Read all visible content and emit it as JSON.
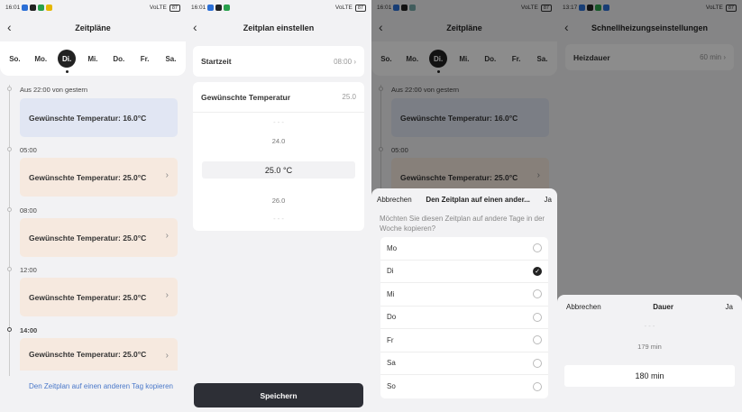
{
  "screen1": {
    "status_time": "16:01",
    "network": "VoLTE",
    "battery": "87",
    "title": "Zeitpläne",
    "days": [
      "So.",
      "Mo.",
      "Di.",
      "Mi.",
      "Do.",
      "Fr.",
      "Sa."
    ],
    "selected_day": "Di.",
    "from_yesterday": "Aus 22:00 von gestern",
    "first_card": "Gewünschte Temperatur: 16.0°C",
    "slots": [
      {
        "time": "05:00",
        "label": "Gewünschte Temperatur: 25.0°C"
      },
      {
        "time": "08:00",
        "label": "Gewünschte Temperatur: 25.0°C"
      },
      {
        "time": "12:00",
        "label": "Gewünschte Temperatur: 25.0°C"
      },
      {
        "time": "14:00",
        "label": "Gewünschte Temperatur: 25.0°C"
      }
    ],
    "copy_link": "Den Zeitplan auf einen anderen Tag kopieren"
  },
  "screen2": {
    "status_time": "16:01",
    "title": "Zeitplan einstellen",
    "start_label": "Startzeit",
    "start_value": "08:00",
    "temp_label": "Gewünschte Temperatur",
    "temp_value": "25.0",
    "picker": [
      "24.0",
      "25.0",
      "26.0"
    ],
    "unit": "°C",
    "save": "Speichern"
  },
  "screen3": {
    "status_time": "16:01",
    "title": "Zeitpläne",
    "cancel": "Abbrechen",
    "sheet_title": "Den Zeitplan auf einen ander...",
    "confirm": "Ja",
    "question": "Möchten Sie diesen Zeitplan auf andere Tage in der Woche kopieren?",
    "days": [
      {
        "label": "Mo",
        "checked": false
      },
      {
        "label": "Di",
        "checked": true
      },
      {
        "label": "Mi",
        "checked": false
      },
      {
        "label": "Do",
        "checked": false
      },
      {
        "label": "Fr",
        "checked": false
      },
      {
        "label": "Sa",
        "checked": false
      },
      {
        "label": "So",
        "checked": false
      }
    ]
  },
  "screen4": {
    "status_time": "13:17",
    "title": "Schnellheizungseinstellungen",
    "heat_label": "Heizdauer",
    "heat_value": "60 min",
    "cancel": "Abbrechen",
    "sheet_title": "Dauer",
    "confirm": "Ja",
    "picker": [
      "179 min",
      "180 min"
    ]
  },
  "colors": {
    "accent_link": "#4a78c9",
    "save_btn": "#2d2f36",
    "card_blue": "#e1e6f3",
    "card_peach": "#f6e9df"
  }
}
